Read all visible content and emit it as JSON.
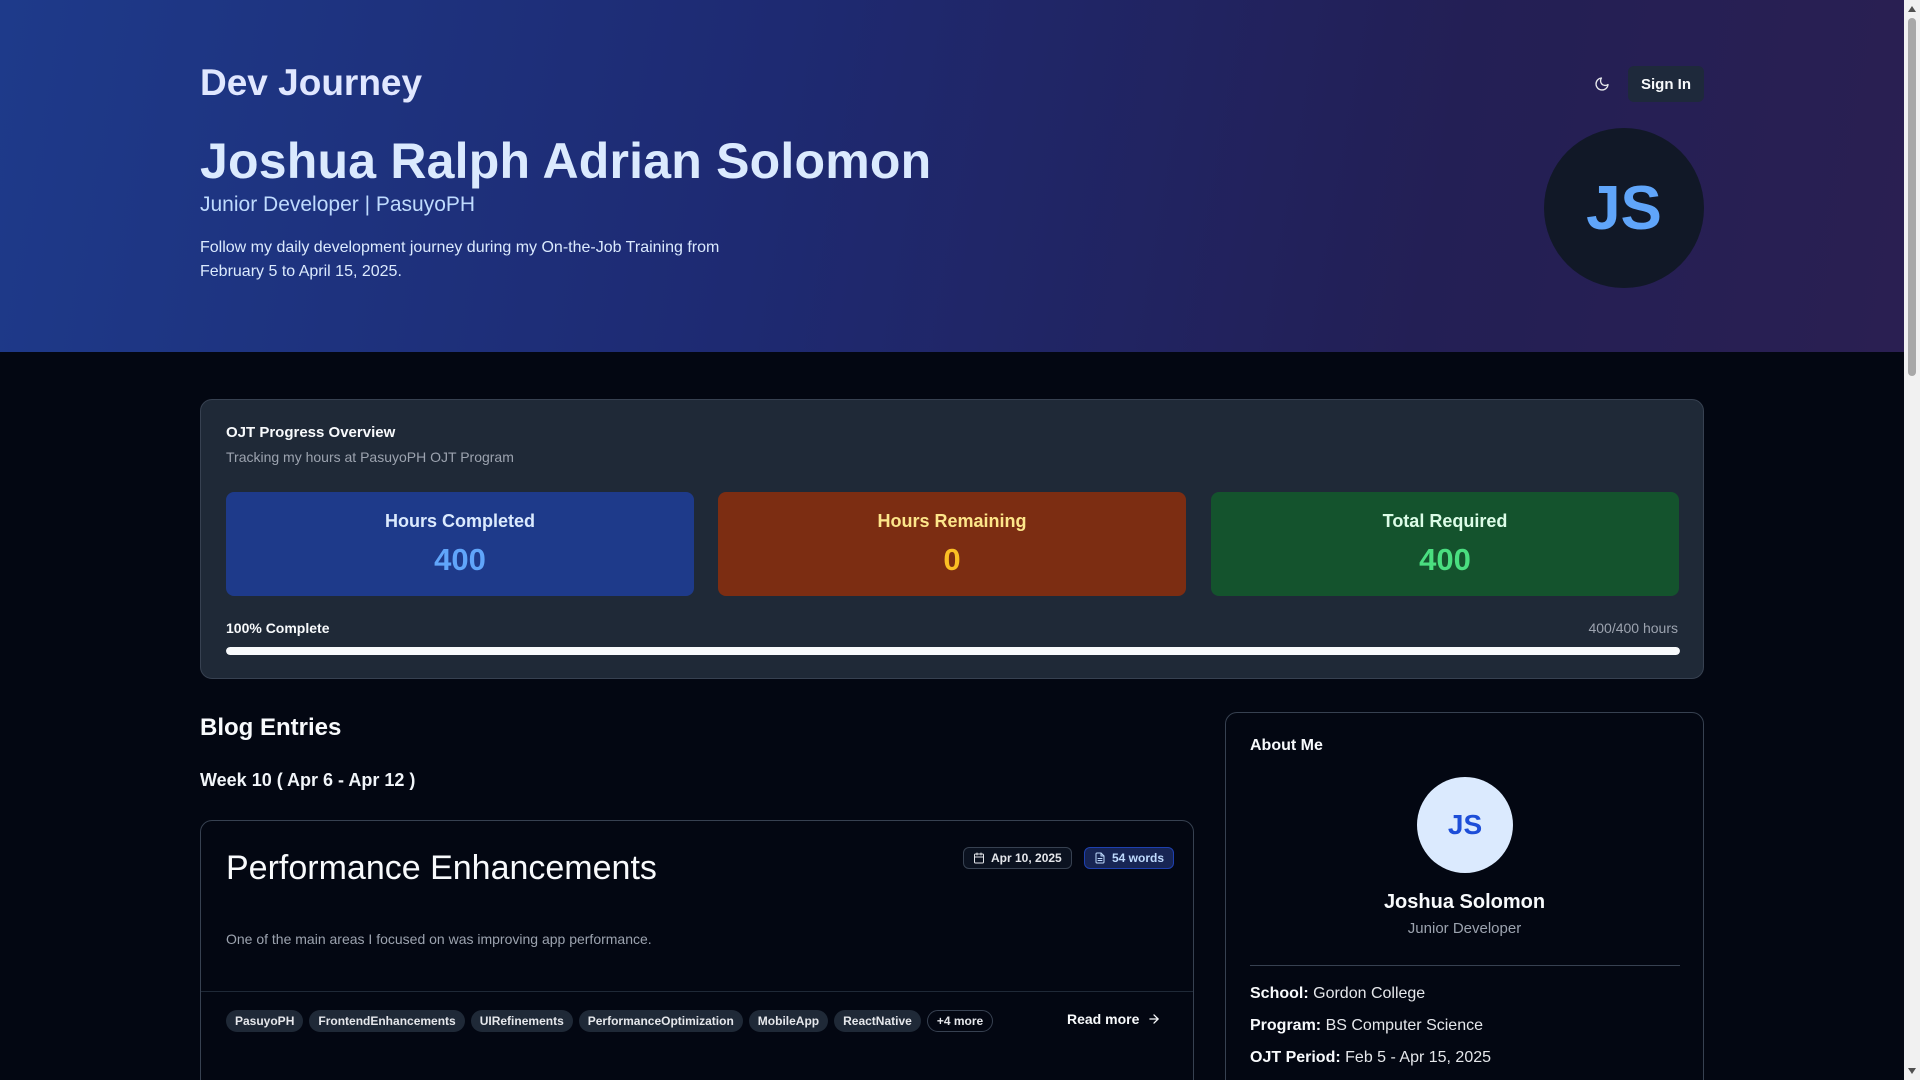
{
  "header": {
    "brand": "Dev Journey",
    "theme_icon": "moon-icon",
    "signin_label": "Sign In"
  },
  "hero": {
    "name": "Joshua Ralph Adrian Solomon",
    "role": "Junior Developer | PasuyoPH",
    "description": "Follow my daily development journey during my On-the-Job Training from February 5 to April 15, 2025.",
    "avatar_initials": "JS"
  },
  "progress": {
    "title": "OJT Progress Overview",
    "subtitle": "Tracking my hours at PasuyoPH OJT Program",
    "stats": [
      {
        "label": "Hours Completed",
        "value": "400"
      },
      {
        "label": "Hours Remaining",
        "value": "0"
      },
      {
        "label": "Total Required",
        "value": "400"
      }
    ],
    "percent_label": "100% Complete",
    "hours_label": "400/400 hours",
    "fraction": 1.0
  },
  "blog": {
    "heading": "Blog Entries",
    "week_heading": "Week 10 ( Apr 6 - Apr 12 )",
    "post": {
      "title": "Performance Enhancements",
      "date": "Apr 10, 2025",
      "words": "54 words",
      "excerpt": "One of the main areas I focused on was improving app performance.",
      "tags": [
        "PasuyoPH",
        "FrontendEnhancements",
        "UIRefinements",
        "PerformanceOptimization",
        "MobileApp",
        "ReactNative"
      ],
      "more_tags": "+4 more",
      "read_more": "Read more"
    }
  },
  "about": {
    "title": "About Me",
    "avatar_initials": "JS",
    "name": "Joshua Solomon",
    "role": "Junior Developer",
    "school_label": "School:",
    "school": "Gordon College",
    "program_label": "Program:",
    "program": "BS Computer Science",
    "period_label": "OJT Period:",
    "period": "Feb 5 - Apr 15, 2025"
  },
  "colors": {
    "accent_blue": "#60a5fa",
    "accent_orange": "#fbbf24",
    "accent_green": "#4ade80"
  }
}
